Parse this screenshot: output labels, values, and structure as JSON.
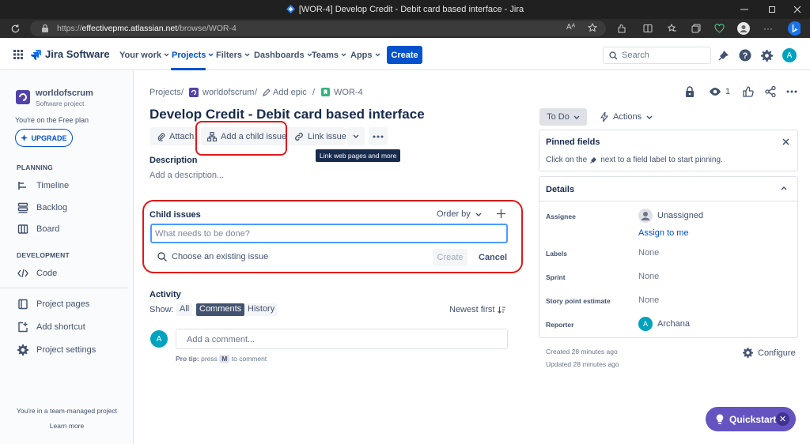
{
  "window": {
    "title": "[WOR-4] Develop Credit - Debit card based interface - Jira"
  },
  "browser": {
    "url_prefix": "https://",
    "url_host": "effectivepmc.atlassian.net",
    "url_path": "/browse/WOR-4"
  },
  "nav": {
    "product": "Jira Software",
    "items": [
      {
        "label": "Your work"
      },
      {
        "label": "Projects"
      },
      {
        "label": "Filters"
      },
      {
        "label": "Dashboards"
      },
      {
        "label": "Teams"
      },
      {
        "label": "Apps"
      }
    ],
    "create_label": "Create",
    "search_placeholder": "Search",
    "user_initial": "A"
  },
  "sidebar": {
    "project_name": "worldofscrum",
    "project_type": "Software project",
    "plan_text": "You're on the Free plan",
    "upgrade_label": "UPGRADE",
    "planning_heading": "PLANNING",
    "planning_items": [
      {
        "label": "Timeline"
      },
      {
        "label": "Backlog"
      },
      {
        "label": "Board"
      }
    ],
    "development_heading": "DEVELOPMENT",
    "development_items": [
      {
        "label": "Code"
      }
    ],
    "other_items": [
      {
        "label": "Project pages"
      },
      {
        "label": "Add shortcut"
      },
      {
        "label": "Project settings"
      }
    ],
    "footer_text": "You're in a team-managed project",
    "learn_more": "Learn more"
  },
  "issue": {
    "breadcrumbs": [
      "Projects",
      "/",
      "worldofscrum",
      "/",
      "Add epic",
      "/",
      "WOR-4"
    ],
    "title": "Develop Credit - Debit card based interface",
    "toolbar": {
      "attach": "Attach",
      "add_child": "Add a child issue",
      "link_issue": "Link issue"
    },
    "tooltip": "Link web pages and more",
    "description_label": "Description",
    "description_placeholder": "Add a description...",
    "child_issues": {
      "label": "Child issues",
      "order_by": "Order by",
      "input_placeholder": "What needs to be done?",
      "choose_existing": "Choose an existing issue",
      "create": "Create",
      "cancel": "Cancel"
    },
    "activity": {
      "label": "Activity",
      "show": "Show:",
      "filters": [
        "All",
        "Comments",
        "History"
      ],
      "sort": "Newest first",
      "comment_placeholder": "Add a comment...",
      "pro_tip_prefix": "Pro tip:",
      "pro_tip_press": "press",
      "pro_tip_key": "M",
      "pro_tip_suffix": "to comment",
      "avatar_initial": "A"
    }
  },
  "right": {
    "watch_count": "1",
    "status": "To Do",
    "actions": "Actions",
    "pinned": {
      "title": "Pinned fields",
      "text_before": "Click on the",
      "text_after": "next to a field label to start pinning."
    },
    "details": {
      "title": "Details",
      "assignee_label": "Assignee",
      "assignee_value": "Unassigned",
      "assign_to_me": "Assign to me",
      "labels_label": "Labels",
      "labels_value": "None",
      "sprint_label": "Sprint",
      "sprint_value": "None",
      "story_label": "Story point estimate",
      "story_value": "None",
      "reporter_label": "Reporter",
      "reporter_value": "Archana",
      "reporter_initial": "A"
    },
    "created": "Created 28 minutes ago",
    "updated": "Updated 28 minutes ago",
    "configure": "Configure"
  },
  "quickstart": {
    "label": "Quickstart"
  },
  "colors": {
    "brand": "#0052cc",
    "highlight": "#e0181a",
    "quickstart": "#6554c0"
  }
}
